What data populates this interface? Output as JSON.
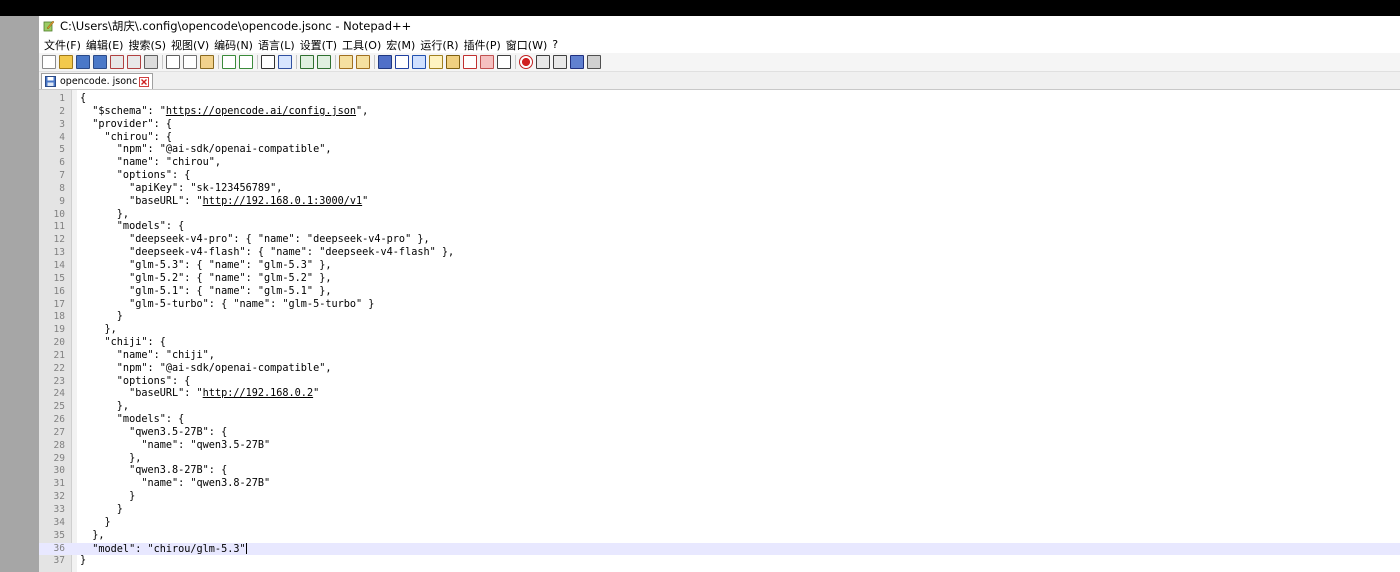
{
  "window": {
    "title": "C:\\Users\\胡庆\\.config\\opencode\\opencode.jsonc - Notepad++"
  },
  "menu": [
    "文件(F)",
    "编辑(E)",
    "搜索(S)",
    "视图(V)",
    "编码(N)",
    "语言(L)",
    "设置(T)",
    "工具(O)",
    "宏(M)",
    "运行(R)",
    "插件(P)",
    "窗口(W)",
    "?"
  ],
  "toolbar": {
    "icons": [
      "new-file-icon",
      "open-file-icon",
      "save-icon",
      "save-all-icon",
      "close-icon",
      "close-all-icon",
      "print-icon",
      "cut-icon",
      "copy-icon",
      "paste-icon",
      "undo-icon",
      "redo-icon",
      "find-icon",
      "replace-icon",
      "zoom-in-icon",
      "zoom-out-icon",
      "sync-vertical-icon",
      "sync-horizontal-icon",
      "word-wrap-icon",
      "show-all-chars-icon",
      "indent-guide-icon",
      "language-panel-icon",
      "doc-map-icon",
      "function-list-icon",
      "folder-workspace-icon",
      "monitoring-icon",
      "record-macro-icon",
      "stop-macro-icon",
      "play-macro-icon",
      "run-macro-multiple-icon",
      "save-macro-icon"
    ]
  },
  "tab": {
    "label": "opencode. jsonc"
  },
  "editor": {
    "current_line": 36,
    "lines": [
      {
        "n": "1",
        "t": "{"
      },
      {
        "n": "2",
        "t": "  \"$schema\": \"",
        "u": "https://opencode.ai/config.json",
        "a": "\","
      },
      {
        "n": "3",
        "t": "  \"provider\": {"
      },
      {
        "n": "4",
        "t": "    \"chirou\": {"
      },
      {
        "n": "5",
        "t": "      \"npm\": \"@ai-sdk/openai-compatible\","
      },
      {
        "n": "6",
        "t": "      \"name\": \"chirou\","
      },
      {
        "n": "7",
        "t": "      \"options\": {"
      },
      {
        "n": "8",
        "t": "        \"apiKey\": \"sk-123456789\","
      },
      {
        "n": "9",
        "t": "        \"baseURL\": \"",
        "u": "http://192.168.0.1:3000/v1",
        "a": "\""
      },
      {
        "n": "10",
        "t": "      },"
      },
      {
        "n": "11",
        "t": "      \"models\": {"
      },
      {
        "n": "12",
        "t": "        \"deepseek-v4-pro\": { \"name\": \"deepseek-v4-pro\" },"
      },
      {
        "n": "13",
        "t": "        \"deepseek-v4-flash\": { \"name\": \"deepseek-v4-flash\" },"
      },
      {
        "n": "14",
        "t": "        \"glm-5.3\": { \"name\": \"glm-5.3\" },"
      },
      {
        "n": "15",
        "t": "        \"glm-5.2\": { \"name\": \"glm-5.2\" },"
      },
      {
        "n": "16",
        "t": "        \"glm-5.1\": { \"name\": \"glm-5.1\" },"
      },
      {
        "n": "17",
        "t": "        \"glm-5-turbo\": { \"name\": \"glm-5-turbo\" }"
      },
      {
        "n": "18",
        "t": "      }"
      },
      {
        "n": "19",
        "t": "    },"
      },
      {
        "n": "20",
        "t": "    \"chiji\": {"
      },
      {
        "n": "21",
        "t": "      \"name\": \"chiji\","
      },
      {
        "n": "22",
        "t": "      \"npm\": \"@ai-sdk/openai-compatible\","
      },
      {
        "n": "23",
        "t": "      \"options\": {"
      },
      {
        "n": "24",
        "t": "        \"baseURL\": \"",
        "u": "http://192.168.0.2",
        "a": "\""
      },
      {
        "n": "25",
        "t": "      },"
      },
      {
        "n": "26",
        "t": "      \"models\": {"
      },
      {
        "n": "27",
        "t": "        \"qwen3.5-27B\": {"
      },
      {
        "n": "28",
        "t": "          \"name\": \"qwen3.5-27B\""
      },
      {
        "n": "29",
        "t": "        },"
      },
      {
        "n": "30",
        "t": "        \"qwen3.8-27B\": {"
      },
      {
        "n": "31",
        "t": "          \"name\": \"qwen3.8-27B\""
      },
      {
        "n": "32",
        "t": "        }"
      },
      {
        "n": "33",
        "t": "      }"
      },
      {
        "n": "34",
        "t": "    }"
      },
      {
        "n": "35",
        "t": "  },"
      },
      {
        "n": "36",
        "t": "  \"model\": \"chirou/glm-5.3\""
      },
      {
        "n": "37",
        "t": "}"
      }
    ]
  }
}
